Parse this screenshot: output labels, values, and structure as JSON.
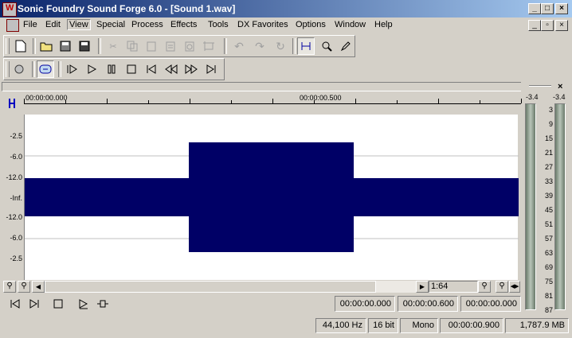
{
  "window": {
    "title": "Sonic Foundry Sound Forge 6.0 - [Sound 1.wav]"
  },
  "menu": [
    "File",
    "Edit",
    "View",
    "Special",
    "Process",
    "Effects",
    "Tools",
    "DX Favorites",
    "Options",
    "Window",
    "Help"
  ],
  "menu_selected": "View",
  "ruler": {
    "start": "00:00:00.000",
    "mid": "00:00:00.500"
  },
  "level_labels": [
    "-2.5",
    "-6.0",
    "-12.0",
    "-Inf.",
    "-12.0",
    "-6.0",
    "-2.5"
  ],
  "meter": {
    "left_peak": "-3.4",
    "right_peak": "-3.4",
    "scale": [
      "3",
      "9",
      "15",
      "21",
      "27",
      "33",
      "39",
      "45",
      "51",
      "57",
      "63",
      "69",
      "75",
      "81",
      "87"
    ]
  },
  "zoom_ratio": "1:64",
  "transport": {
    "selection_start": "00:00:00.000",
    "selection_end": "00:00:00.600",
    "selection_length": "00:00:00.000"
  },
  "status": {
    "sample_rate": "44,100 Hz",
    "bit_depth": "16 bit",
    "channels": "Mono",
    "length": "00:00:00.900",
    "free_space": "1,787.9 MB"
  },
  "colors": {
    "waveform": "#000066",
    "titlebar_start": "#0a246a",
    "titlebar_end": "#a6caf0"
  }
}
